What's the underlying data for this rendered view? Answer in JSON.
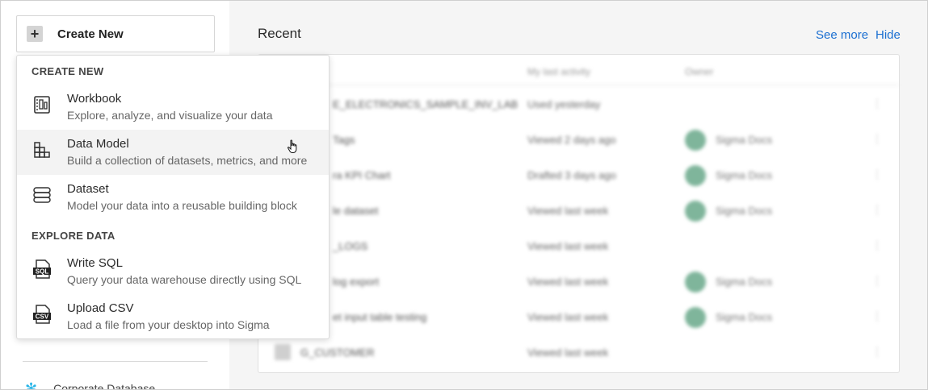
{
  "sidebar": {
    "create_label": "Create New",
    "bottom_item": "Corporate Database"
  },
  "main": {
    "title": "Recent",
    "see_more": "See more",
    "hide": "Hide",
    "columns": [
      "My last activity",
      "Owner"
    ],
    "rows": [
      {
        "name": "E_ELECTRONICS_SAMPLE_INV_LAB",
        "activity": "Used yesterday",
        "owner": ""
      },
      {
        "name": "Tags",
        "activity": "Viewed 2 days ago",
        "owner": "Sigma Docs"
      },
      {
        "name": "ra KPI Chart",
        "activity": "Drafted 3 days ago",
        "owner": "Sigma Docs"
      },
      {
        "name": "le dataset",
        "activity": "Viewed last week",
        "owner": "Sigma Docs"
      },
      {
        "name": "_LOGS",
        "activity": "Viewed last week",
        "owner": ""
      },
      {
        "name": "log export",
        "activity": "Viewed last week",
        "owner": "Sigma Docs"
      },
      {
        "name": "et input table testing",
        "activity": "Viewed last week",
        "owner": "Sigma Docs"
      },
      {
        "name": "G_CUSTOMER",
        "activity": "Viewed last week",
        "owner": ""
      }
    ]
  },
  "dropdown": {
    "section_create": "CREATE NEW",
    "section_explore": "EXPLORE DATA",
    "items": [
      {
        "title": "Workbook",
        "desc": "Explore, analyze, and visualize your data",
        "icon": "workbook-icon"
      },
      {
        "title": "Data Model",
        "desc": "Build a collection of datasets, metrics, and more",
        "icon": "data-model-icon"
      },
      {
        "title": "Dataset",
        "desc": "Model your data into a reusable building block",
        "icon": "dataset-icon"
      },
      {
        "title": "Write SQL",
        "desc": "Query your data warehouse directly using SQL",
        "icon": "sql-file-icon"
      },
      {
        "title": "Upload CSV",
        "desc": "Load a file from your desktop into Sigma",
        "icon": "csv-file-icon"
      }
    ],
    "sql_badge": "SQL",
    "csv_badge": "CSV"
  },
  "colors": {
    "link": "#1a6fd1",
    "avatar": "#7fb59b",
    "hover": "#f3f3f3"
  }
}
